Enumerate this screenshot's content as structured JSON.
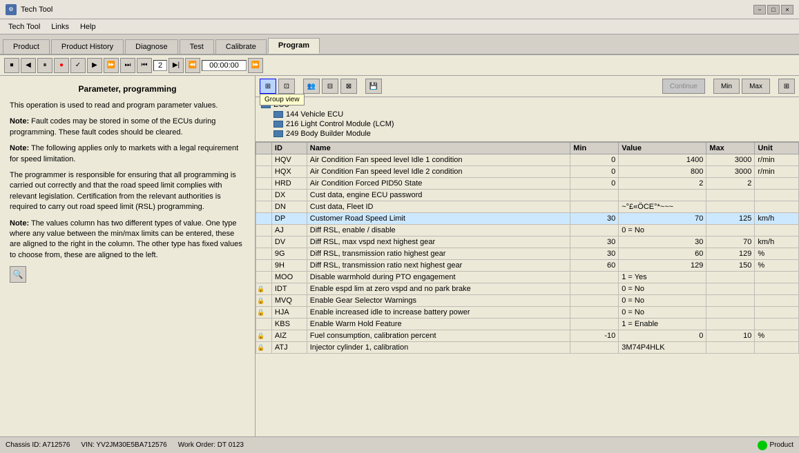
{
  "titleBar": {
    "icon": "⚙",
    "title": "Tech Tool",
    "minimizeLabel": "−",
    "maximizeLabel": "□",
    "closeLabel": "×"
  },
  "menuBar": {
    "items": [
      {
        "label": "Tech Tool",
        "id": "menu-tech-tool"
      },
      {
        "label": "Links",
        "id": "menu-links"
      },
      {
        "label": "Help",
        "id": "menu-help"
      }
    ]
  },
  "tabs": [
    {
      "label": "Product",
      "id": "tab-product",
      "active": false
    },
    {
      "label": "Product History",
      "id": "tab-product-history",
      "active": false
    },
    {
      "label": "Diagnose",
      "id": "tab-diagnose",
      "active": false
    },
    {
      "label": "Test",
      "id": "tab-test",
      "active": false
    },
    {
      "label": "Calibrate",
      "id": "tab-calibrate",
      "active": false
    },
    {
      "label": "Program",
      "id": "tab-program",
      "active": true
    }
  ],
  "toolbar": {
    "timeValue": "00:00:00",
    "stepValue": "2"
  },
  "leftPanel": {
    "title": "Parameter, programming",
    "intro": "This operation is used to read and program parameter values.",
    "notes": [
      {
        "label": "Note:",
        "text": " Fault codes may be stored in some of the ECUs during programming. These fault codes should be cleared."
      },
      {
        "label": "Note:",
        "text": " The following applies only to markets with a legal requirement for speed limitation."
      },
      {
        "label": "",
        "text": "The programmer is responsible for ensuring that all programming is carried out correctly and that the road speed limit complies with relevant legislation. Certification from the relevant authorities is required to carry out road speed limit (RSL) programming."
      },
      {
        "label": "Note:",
        "text": " The values column has two different types of value. One type where any value between the min/max limits can be entered, these are aligned to the right in the column. The other type has fixed values to choose from, these are aligned to the left."
      }
    ]
  },
  "rightToolbar": {
    "groupViewTooltip": "Group view",
    "buttons": [
      {
        "id": "btn-grid",
        "icon": "⊞",
        "active": true
      },
      {
        "id": "btn-list",
        "icon": "≡",
        "active": false
      },
      {
        "id": "btn-people",
        "icon": "👥",
        "active": false
      },
      {
        "id": "btn-small",
        "icon": "⊟",
        "active": false
      },
      {
        "id": "btn-large",
        "icon": "⊞",
        "active": false
      },
      {
        "id": "btn-save",
        "icon": "💾",
        "active": false
      }
    ],
    "continueLabel": "Continue",
    "minLabel": "Min",
    "maxLabel": "Max",
    "tableIcon": "⊞"
  },
  "ecuTree": {
    "header": "ECU",
    "items": [
      {
        "id": "144",
        "label": "Vehicle ECU"
      },
      {
        "id": "216",
        "label": "Light Control Module (LCM)"
      },
      {
        "id": "249",
        "label": "Body Builder Module"
      }
    ]
  },
  "tableHeaders": {
    "col0": "",
    "id": "ID",
    "name": "Name",
    "min": "Min",
    "value": "Value",
    "max": "Max",
    "unit": "Unit"
  },
  "tableRows": [
    {
      "locked": false,
      "id": "HQV",
      "name": "Air Condition Fan speed level Idle 1 condition",
      "min": "0",
      "value": "1400",
      "max": "3000",
      "unit": "r/min"
    },
    {
      "locked": false,
      "id": "HQX",
      "name": "Air Condition Fan speed level Idle 2 condition",
      "min": "0",
      "value": "800",
      "max": "3000",
      "unit": "r/min"
    },
    {
      "locked": false,
      "id": "HRD",
      "name": "Air Condition Forced PID50 State",
      "min": "0",
      "value": "2",
      "max": "2",
      "unit": ""
    },
    {
      "locked": false,
      "id": "DX",
      "name": "Cust data, engine ECU password",
      "min": "",
      "value": "",
      "max": "",
      "unit": ""
    },
    {
      "locked": false,
      "id": "DN",
      "name": "Cust data, Fleet ID",
      "min": "",
      "value": "~°£«ÖCE°*~~~",
      "max": "",
      "unit": ""
    },
    {
      "locked": false,
      "id": "DP",
      "name": "Customer Road Speed Limit",
      "min": "30",
      "value": "70",
      "max": "125",
      "unit": "km/h",
      "highlighted": true
    },
    {
      "locked": false,
      "id": "AJ",
      "name": "Diff RSL, enable / disable",
      "min": "",
      "value": "0 = No",
      "max": "",
      "unit": ""
    },
    {
      "locked": false,
      "id": "DV",
      "name": "Diff RSL, max vspd next highest gear",
      "min": "30",
      "value": "30",
      "max": "70",
      "unit": "km/h"
    },
    {
      "locked": false,
      "id": "9G",
      "name": "Diff RSL, transmission ratio highest gear",
      "min": "30",
      "value": "60",
      "max": "129",
      "unit": "%"
    },
    {
      "locked": false,
      "id": "9H",
      "name": "Diff RSL, transmission ratio next highest gear",
      "min": "60",
      "value": "129",
      "max": "150",
      "unit": "%"
    },
    {
      "locked": false,
      "id": "MOO",
      "name": "Disable warmhold during PTO engagement",
      "min": "",
      "value": "1 = Yes",
      "max": "",
      "unit": ""
    },
    {
      "locked": true,
      "id": "IDT",
      "name": "Enable espd lim at zero vspd and no park brake",
      "min": "",
      "value": "0 = No",
      "max": "",
      "unit": ""
    },
    {
      "locked": true,
      "id": "MVQ",
      "name": "Enable Gear Selector Warnings",
      "min": "",
      "value": "0 = No",
      "max": "",
      "unit": ""
    },
    {
      "locked": true,
      "id": "HJA",
      "name": "Enable increased idle to increase battery power",
      "min": "",
      "value": "0 = No",
      "max": "",
      "unit": ""
    },
    {
      "locked": false,
      "id": "KBS",
      "name": "Enable Warm Hold Feature",
      "min": "",
      "value": "1 = Enable",
      "max": "",
      "unit": ""
    },
    {
      "locked": true,
      "id": "AIZ",
      "name": "Fuel consumption, calibration percent",
      "min": "-10",
      "value": "0",
      "max": "10",
      "unit": "%"
    },
    {
      "locked": true,
      "id": "ATJ",
      "name": "Injector cylinder 1, calibration",
      "min": "",
      "value": "3M74P4HLK",
      "max": "",
      "unit": ""
    }
  ],
  "statusBar": {
    "chassisId": "Chassis ID: A712576",
    "vin": "VIN: YV2JM30E5BA712576",
    "workOrder": "Work Order: DT 0123",
    "productLabel": "Product"
  }
}
